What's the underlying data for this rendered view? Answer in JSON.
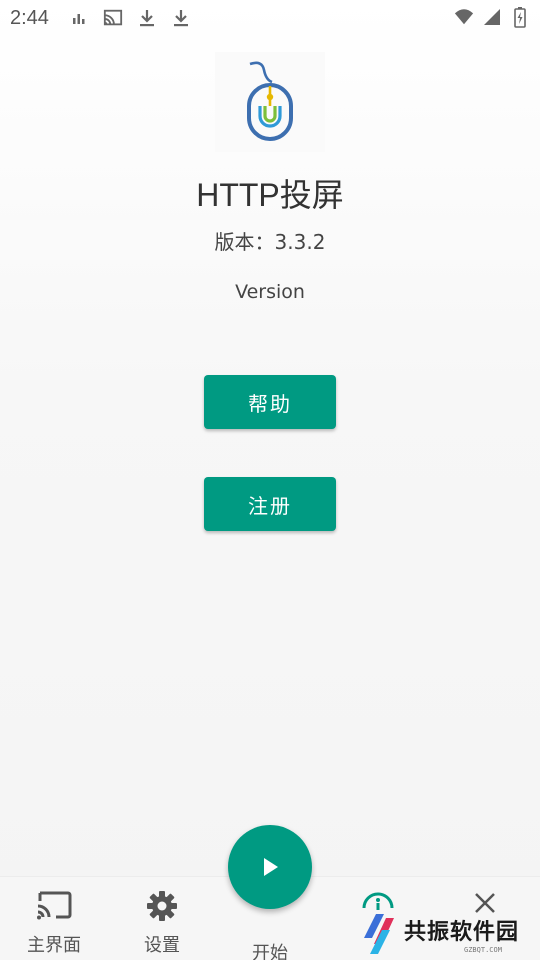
{
  "status_bar": {
    "time": "2:44",
    "left_icons": [
      "signal-bars-icon",
      "cast-icon",
      "download-icon",
      "download-icon"
    ],
    "right_icons": [
      "wifi-icon",
      "cell-signal-icon",
      "battery-charging-icon"
    ]
  },
  "app": {
    "logo_icon": "mouse-icon",
    "title": "HTTP投屏",
    "version": "版本：3.3.2",
    "version_label": "Version"
  },
  "buttons": {
    "help": "帮助",
    "register": "注册"
  },
  "bottom_nav": {
    "items": [
      {
        "label": "主界面",
        "icon": "cast-screen-icon"
      },
      {
        "label": "设置",
        "icon": "gear-icon"
      },
      {
        "label": "开始",
        "icon": "play-icon"
      }
    ],
    "extra_icons": [
      "info-icon",
      "close-icon"
    ]
  },
  "watermark": {
    "text": "共振软件园",
    "sub": "GZBQT.COM"
  },
  "colors": {
    "accent": "#009a82",
    "background": "#f6f6f6"
  }
}
